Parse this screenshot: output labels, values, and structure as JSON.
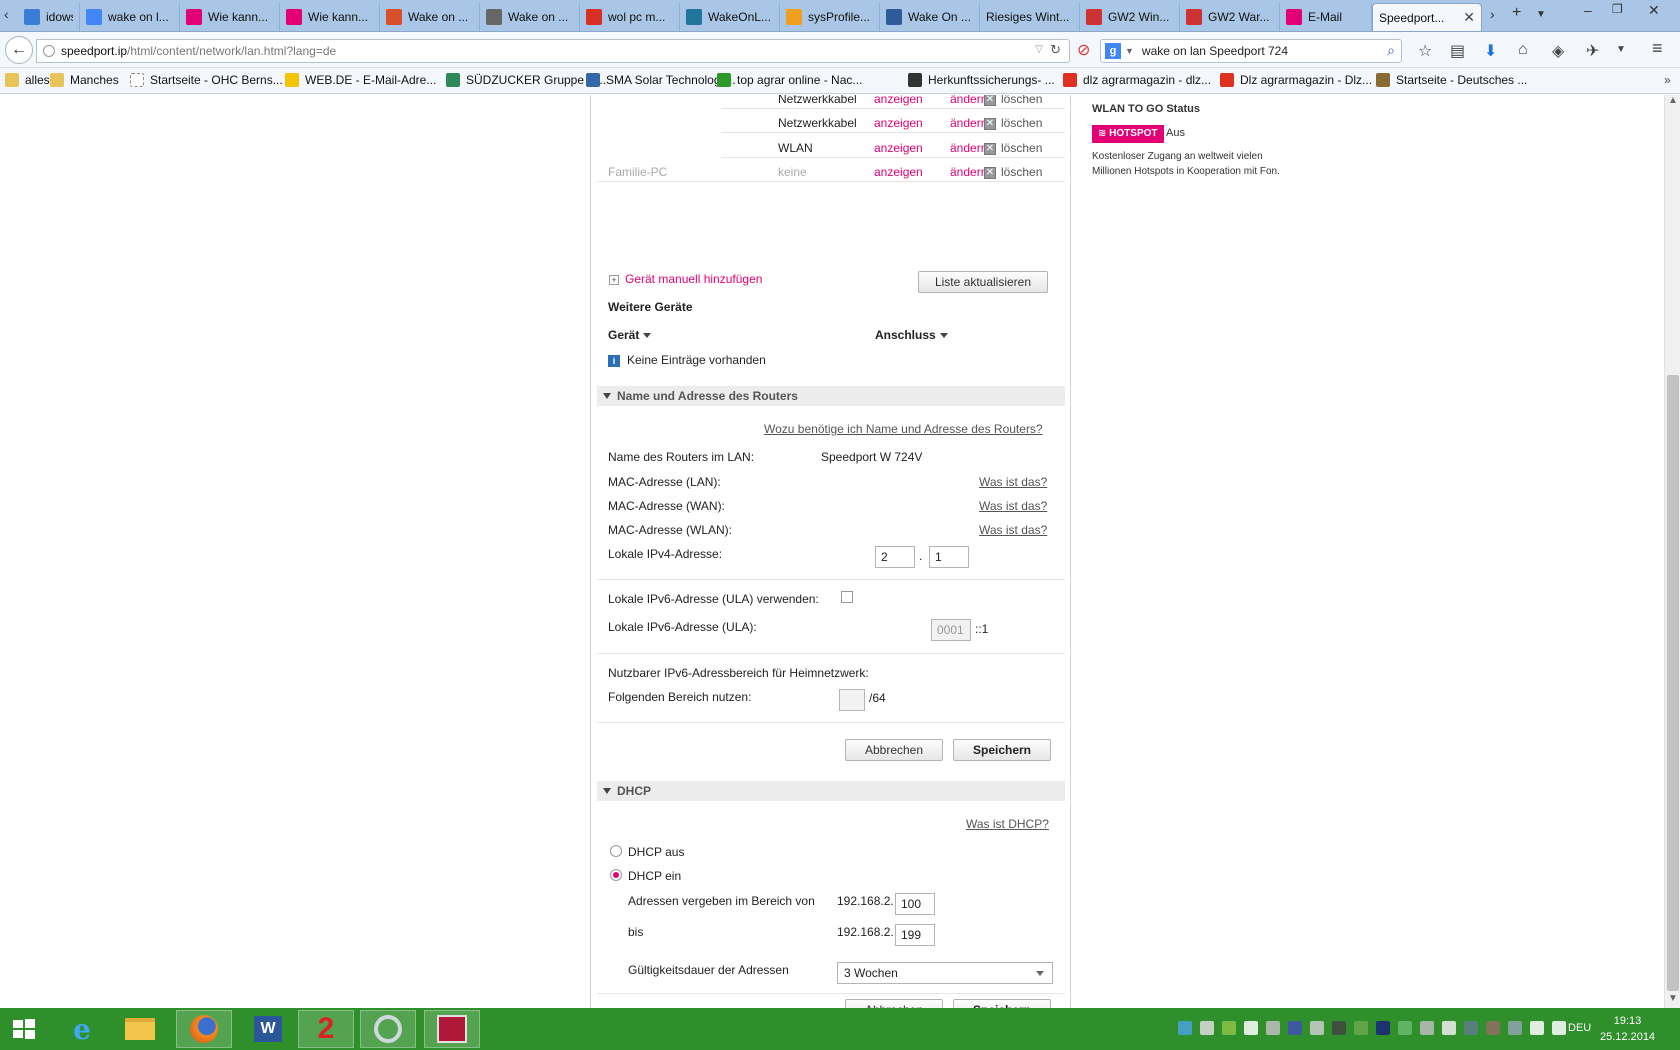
{
  "browser": {
    "tabs": [
      {
        "label": "idows...",
        "fav": "#3a7bd5"
      },
      {
        "label": "wake on l...",
        "fav": "#4285f4"
      },
      {
        "label": "Wie kann...",
        "fav": "#e20074"
      },
      {
        "label": "Wie kann...",
        "fav": "#e20074"
      },
      {
        "label": "Wake on ...",
        "fav": "#d94f2b"
      },
      {
        "label": "Wake on ...",
        "fav": "#666666"
      },
      {
        "label": "wol pc m...",
        "fav": "#d93025"
      },
      {
        "label": "WakeOnL...",
        "fav": "#21759b"
      },
      {
        "label": "sysProfile...",
        "fav": "#f0a020"
      },
      {
        "label": "Wake On ...",
        "fav": "#2e5c9a"
      },
      {
        "label": "Riesiges Wint...",
        "fav": ""
      },
      {
        "label": "GW2 Win...",
        "fav": "#cc3333"
      },
      {
        "label": "GW2 War...",
        "fav": "#cc3333"
      },
      {
        "label": "E-Mail",
        "fav": "#e20074"
      },
      {
        "label": "Speedport...",
        "fav": ""
      }
    ],
    "url_host": "speedport.ip",
    "url_path": "/html/content/network/lan.html?lang=de",
    "search_value": "wake on lan Speedport 724",
    "bookmarks": [
      {
        "label": "alles",
        "color": "#e8c45a"
      },
      {
        "label": "Manches",
        "color": "#e8c45a"
      },
      {
        "label": "Startseite - OHC Berns...",
        "color": "#ffffff"
      },
      {
        "label": "WEB.DE - E-Mail-Adre...",
        "color": "#f5c400"
      },
      {
        "label": "SÜDZUCKER Gruppe R...",
        "color": "#2e8b57"
      },
      {
        "label": "SMA Solar Technology...",
        "color": "#3366aa"
      },
      {
        "label": "top agrar online - Nac...",
        "color": "#2a9a2a"
      },
      {
        "label": "Herkunftssicherungs- ...",
        "color": "#333333"
      },
      {
        "label": "dlz agrarmagazin - dlz...",
        "color": "#e03020"
      },
      {
        "label": "Dlz agrarmagazin - Dlz...",
        "color": "#e03020"
      },
      {
        "label": "Startseite - Deutsches ...",
        "color": "#8a6a30"
      }
    ]
  },
  "devices": {
    "rows": [
      {
        "name": "",
        "conn": "Netzwerkkabel"
      },
      {
        "name": "",
        "conn": "Netzwerkkabel"
      },
      {
        "name": "",
        "conn": "WLAN"
      },
      {
        "name": "Familie-PC",
        "conn": "keine"
      }
    ],
    "show": "anzeigen",
    "edit": "ändern",
    "delete": "löschen",
    "add_manual": "Gerät manuell hinzufügen",
    "refresh": "Liste aktualisieren",
    "more_title": "Weitere Geräte",
    "col_device": "Gerät",
    "col_conn": "Anschluss",
    "empty": "Keine Einträge vorhanden"
  },
  "router": {
    "section": "Name und Adresse des Routers",
    "help": "Wozu benötige ich Name und Adresse des Routers?",
    "name_label": "Name des Routers im LAN:",
    "name_value": "Speedport W 724V",
    "mac_lan": "MAC-Adresse (LAN):",
    "mac_wan": "MAC-Adresse (WAN):",
    "mac_wlan": "MAC-Adresse (WLAN):",
    "what": "Was ist das?",
    "ipv4_label": "Lokale IPv4-Adresse:",
    "ipv4_a": "2",
    "ipv4_b": "1",
    "dot": ".",
    "ula_use": "Lokale IPv6-Adresse (ULA) verwenden:",
    "ula_label": "Lokale IPv6-Adresse (ULA):",
    "ula_value": "0001",
    "ula_suffix": "::1",
    "range_title": "Nutzbarer IPv6-Adressbereich für Heimnetzwerk:",
    "range_label": "Folgenden Bereich nutzen:",
    "range_suffix": "/64",
    "cancel": "Abbrechen",
    "save": "Speichern"
  },
  "dhcp": {
    "section": "DHCP",
    "help": "Was ist DHCP?",
    "off": "DHCP aus",
    "on": "DHCP ein",
    "from_label": "Adressen vergeben im Bereich von",
    "prefix": "192.168.2.",
    "from_value": "100",
    "to_label": "bis",
    "to_value": "199",
    "lease_label": "Gültigkeitsdauer der Adressen",
    "lease_value": "3 Wochen",
    "cancel": "Abbrechen",
    "save": "Speichern"
  },
  "sidebar": {
    "title": "WLAN TO GO Status",
    "badge": "HOTSPOT",
    "status": "Aus",
    "desc1": "Kostenloser Zugang an weltweit vielen",
    "desc2": "Millionen Hotspots in Kooperation mit Fon."
  },
  "taskbar": {
    "lang": "DEU",
    "time": "19:13",
    "date": "25.12.2014"
  }
}
